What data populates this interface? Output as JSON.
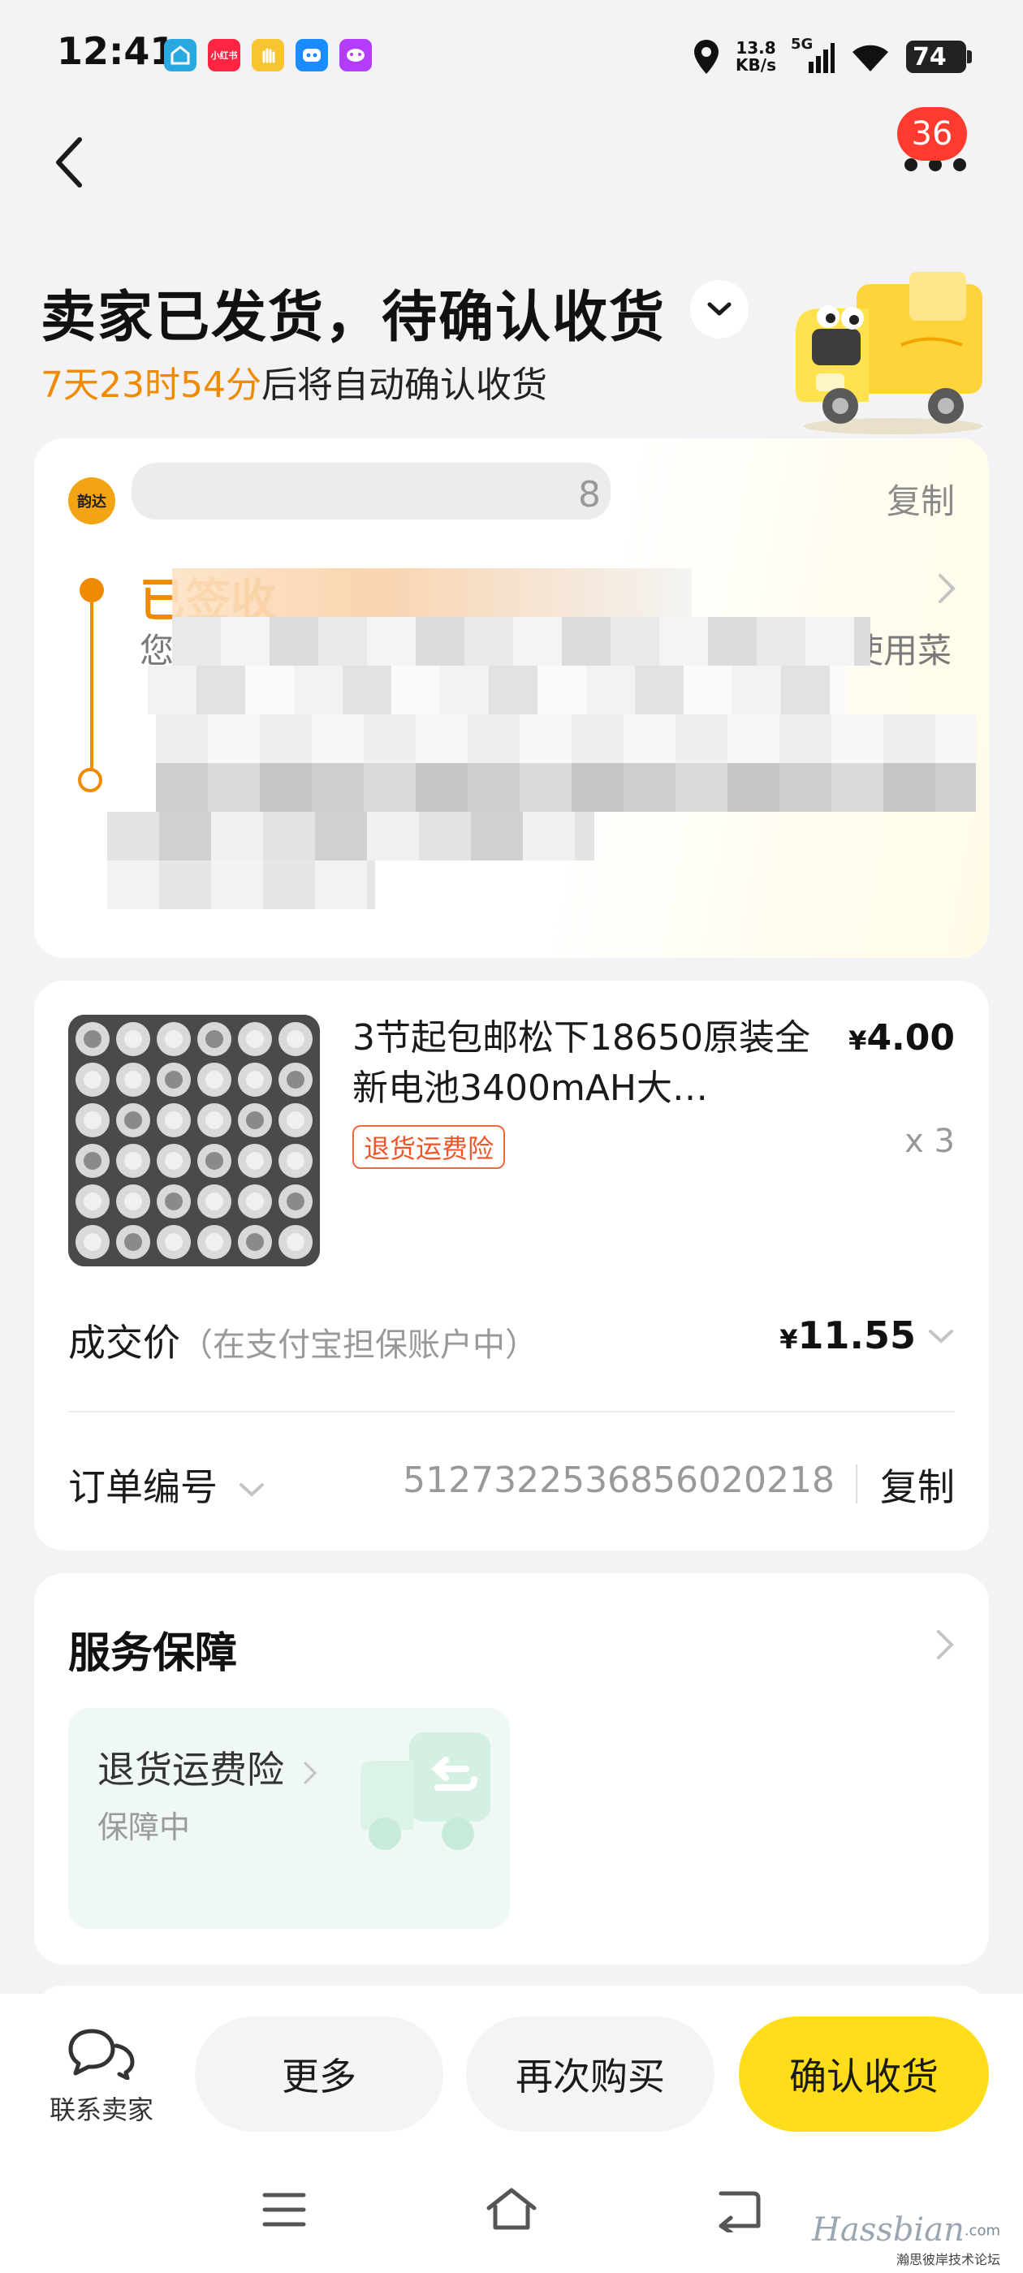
{
  "status_bar": {
    "time": "12:41",
    "apps": [
      {
        "icon": "app-a-icon",
        "color": "#2aa8e0",
        "label": ""
      },
      {
        "icon": "xiaohongshu-icon",
        "color": "#ff2442",
        "label": "小红书"
      },
      {
        "icon": "hand-icon",
        "color": "#f7c531",
        "label": ""
      },
      {
        "icon": "robot-app-icon",
        "color": "#1a8cff",
        "label": ""
      },
      {
        "icon": "game-app-icon",
        "color": "#b33cff",
        "label": ""
      }
    ],
    "net_speed_value": "13.8",
    "net_speed_unit": "KB/s",
    "network_type": "5G",
    "battery": "74"
  },
  "nav": {
    "badge_count": "36"
  },
  "header": {
    "title": "卖家已发货，待确认收货",
    "countdown": "7天23时54分",
    "countdown_suffix": "后将自动确认收货"
  },
  "logistics": {
    "carrier_logo_text": "韵达",
    "tracking_number_visible": "8",
    "copy_label": "复制",
    "latest_status": "已签收",
    "detail_prefix": "您",
    "detail_suffix": "请使用菜"
  },
  "product": {
    "title": "3节起包邮松下18650原装全新电池3400mAH大…",
    "unit_price_symbol": "¥",
    "unit_price": "4.00",
    "quantity": "x 3",
    "tag": "退货运费险"
  },
  "deal": {
    "label": "成交价",
    "note": "（在支付宝担保账户中）",
    "price_symbol": "¥",
    "price": "11.55"
  },
  "order": {
    "label": "订单编号",
    "number": "5127322536856020218",
    "copy_label": "复制"
  },
  "service": {
    "title": "服务保障",
    "item_name": "退货运费险",
    "item_status": "保障中"
  },
  "bottom_actions": {
    "contact_label": "联系卖家",
    "more_label": "更多",
    "rebuy_label": "再次购买",
    "confirm_label": "确认收货"
  },
  "watermark": {
    "brand": "Hassbian",
    "domain": ".com",
    "caption": "瀚思彼岸技术论坛"
  },
  "colors": {
    "accent_orange": "#f08a00",
    "confirm_yellow": "#ffdd1a",
    "tag_red": "#f0552a",
    "badge_red": "#ff3b30"
  }
}
